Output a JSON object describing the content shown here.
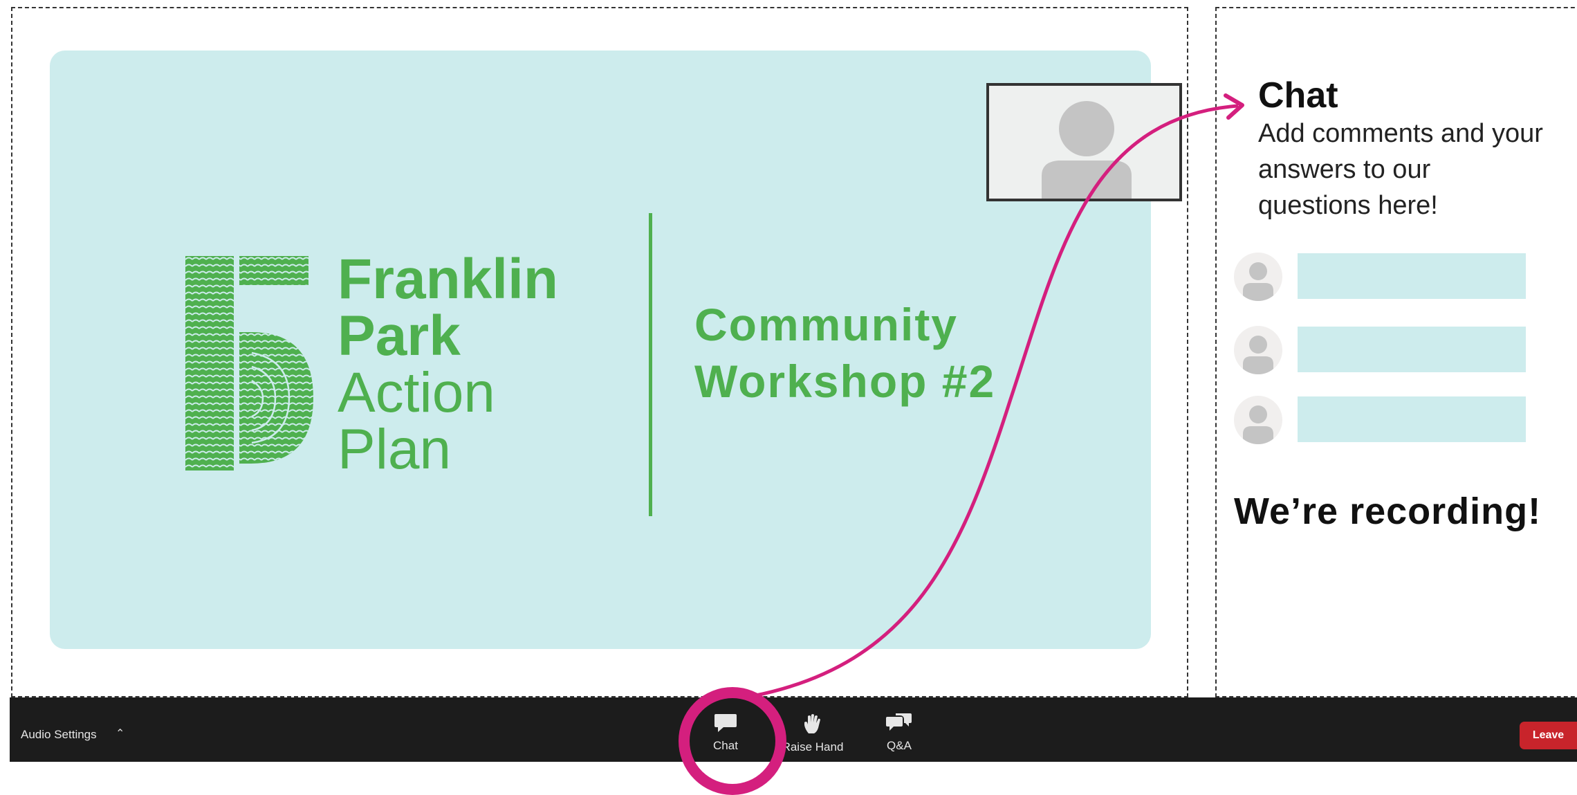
{
  "slide": {
    "logo_text": [
      "Franklin",
      "Park",
      "Action",
      "Plan"
    ],
    "event_title": [
      "Community",
      "Workshop #2"
    ]
  },
  "chat_panel": {
    "title": "Chat",
    "description": "Add comments and your answers to our questions here!",
    "sample_messages": 3,
    "recording_notice": "We’re recording!"
  },
  "toolbar": {
    "audio_settings_label": "Audio Settings",
    "buttons": [
      {
        "label": "Chat",
        "icon": "chat-bubble-icon"
      },
      {
        "label": "Raise Hand",
        "icon": "raise-hand-icon"
      },
      {
        "label": "Q&A",
        "icon": "qa-bubbles-icon"
      }
    ],
    "leave_label": "Leave"
  },
  "colors": {
    "slide_bg": "#cdeced",
    "brand_green": "#4fb04f",
    "highlight_magenta": "#d41f7e",
    "toolbar_bg": "#1c1c1c",
    "leave_red": "#c8242b"
  }
}
